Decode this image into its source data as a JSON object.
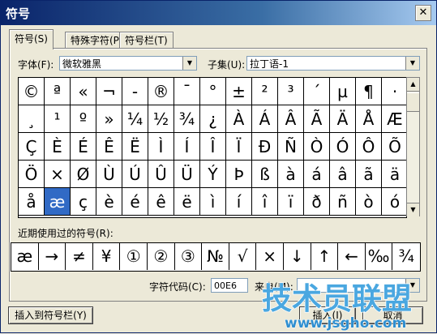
{
  "window": {
    "title": "符号",
    "close_glyph": "✕"
  },
  "tabs": [
    {
      "label": "符号(S)",
      "active": true
    },
    {
      "label": "特殊字符(P)",
      "active": false
    },
    {
      "label": "符号栏(T)",
      "active": false
    }
  ],
  "font": {
    "label": "字体(F):",
    "value": "微软雅黑"
  },
  "subset": {
    "label": "子集(U):",
    "value": "拉丁语-1"
  },
  "symbols": [
    [
      "©",
      "ª",
      "«",
      "¬",
      "-",
      "®",
      "¯",
      "°",
      "±",
      "²",
      "³",
      "´",
      "µ",
      "¶",
      "·"
    ],
    [
      "¸",
      "¹",
      "º",
      "»",
      "¼",
      "½",
      "¾",
      "¿",
      "À",
      "Á",
      "Â",
      "Ã",
      "Ä",
      "Å",
      "Æ"
    ],
    [
      "Ç",
      "È",
      "É",
      "Ê",
      "Ë",
      "Ì",
      "Í",
      "Î",
      "Ï",
      "Ð",
      "Ñ",
      "Ò",
      "Ó",
      "Ô",
      "Õ"
    ],
    [
      "Ö",
      "×",
      "Ø",
      "Ù",
      "Ú",
      "Û",
      "Ü",
      "Ý",
      "Þ",
      "ß",
      "à",
      "á",
      "â",
      "ã",
      "ä"
    ],
    [
      "å",
      "æ",
      "ç",
      "è",
      "é",
      "ê",
      "ë",
      "ì",
      "í",
      "î",
      "ï",
      "ð",
      "ñ",
      "ò",
      "ó"
    ]
  ],
  "selected_symbol": "æ",
  "recent": {
    "label": "近期使用过的符号(R):",
    "items": [
      "æ",
      "→",
      "≠",
      "¥",
      "①",
      "②",
      "③",
      "№",
      "√",
      "×",
      "↓",
      "↑",
      "←",
      "‰",
      "¾"
    ]
  },
  "char_code": {
    "label": "字符代码(C):",
    "value": "00E6"
  },
  "from_label": "来自(M):",
  "buttons": {
    "insert_to_bar": "插入到符号栏(Y)",
    "insert": "插入(I)",
    "cancel": "取消"
  },
  "watermark": {
    "main": "技术员联盟",
    "url": "www.jsgho.com"
  }
}
